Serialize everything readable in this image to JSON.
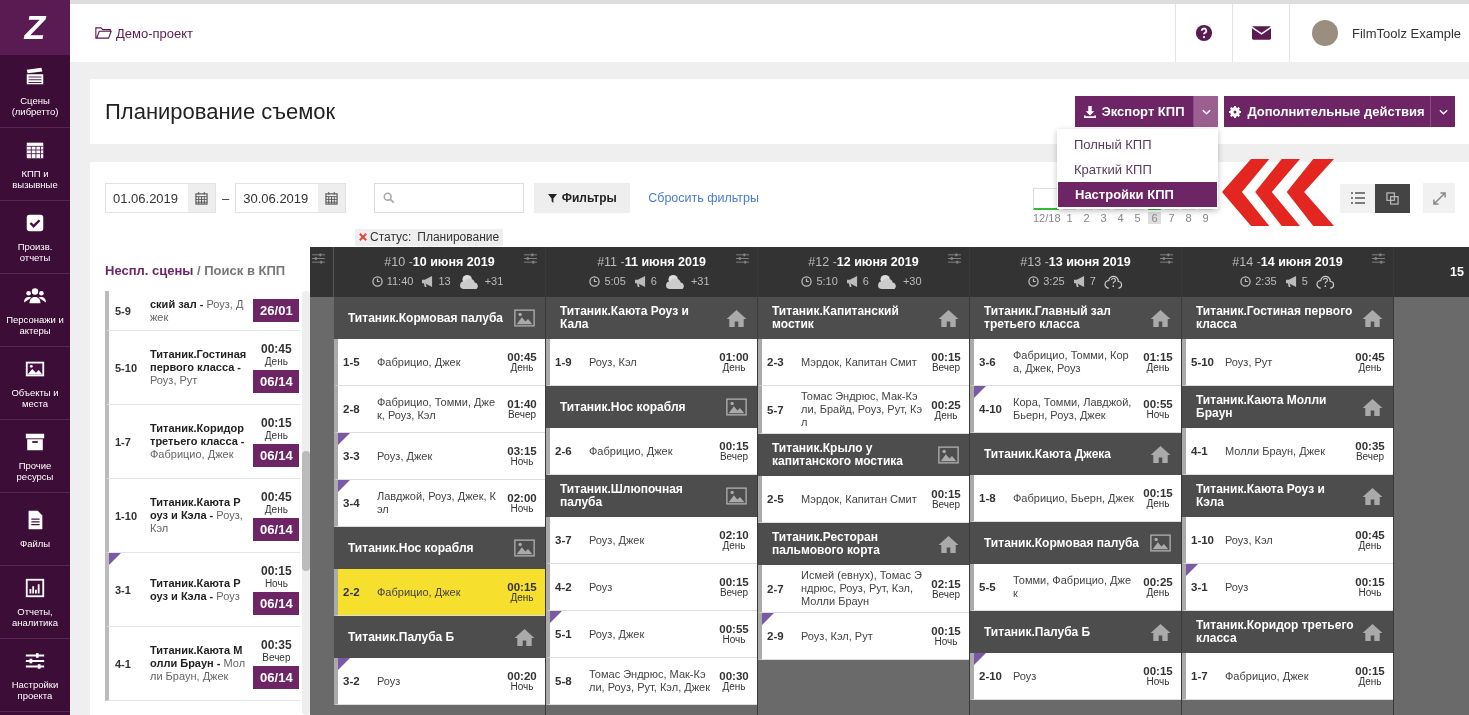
{
  "logo": "Z",
  "sidebar": {
    "items": [
      {
        "label": "Сцены (либретто)"
      },
      {
        "label": "КПП и вызывные"
      },
      {
        "label": "Произв. отчеты"
      },
      {
        "label": "Персонажи и актеры"
      },
      {
        "label": "Объекты и места"
      },
      {
        "label": "Прочие ресурсы"
      },
      {
        "label": "Файлы"
      },
      {
        "label": "Отчеты, аналитика"
      },
      {
        "label": "Настройки проекта"
      }
    ]
  },
  "topbar": {
    "breadcrumb": "Демо-проект",
    "user": "FilmToolz Example"
  },
  "page_title": "Планирование съемок",
  "export_button": {
    "label": "Экспорт КПП",
    "expanded": true
  },
  "export_menu": [
    {
      "label": "Полный КПП",
      "selected": false
    },
    {
      "label": "Краткий КПП",
      "selected": false
    },
    {
      "label": "Настройки КПП",
      "selected": true
    }
  ],
  "actions_button": {
    "label": "Дополнительные действия"
  },
  "filters": {
    "date_from": "01.06.2019",
    "date_to": "30.06.2019",
    "dash": "–",
    "filter_button": "Фильтры",
    "reset_link": "Сбросить фильтры",
    "chip_label": "Статус:",
    "chip_value": "Планирование"
  },
  "day_strip": {
    "total": "12/18",
    "days": [
      {
        "label": "1",
        "selected": false
      },
      {
        "label": "2",
        "selected": false
      },
      {
        "label": "3",
        "selected": false
      },
      {
        "label": "4",
        "selected": false
      },
      {
        "label": "5",
        "selected": false
      },
      {
        "label": "6",
        "selected": true
      },
      {
        "label": "7",
        "selected": false
      },
      {
        "label": "8",
        "selected": false
      },
      {
        "label": "9",
        "selected": false
      }
    ]
  },
  "view_buttons": [
    {
      "kind": "list",
      "selected": false
    },
    {
      "kind": "board",
      "selected": true
    }
  ],
  "unscheduled": {
    "title": "Неспл. сцены",
    "search_tab": "/ Поиск в КПП",
    "items": [
      {
        "scene": "5-9",
        "text": "**ский зал -** Роуз, Джек",
        "badge": "26/01",
        "flagged": false
      },
      {
        "scene": "5-10",
        "text": "**Титаник.Гостиная первого класса -** Роуз, Рут",
        "time": "00:45",
        "daypart": "День",
        "badge": "06/14",
        "flagged": false
      },
      {
        "scene": "1-7",
        "text": "**Титаник.Коридор третьего класса -** Фабрицио, Джек",
        "time": "00:15",
        "daypart": "День",
        "badge": "06/14",
        "flagged": false
      },
      {
        "scene": "1-10",
        "text": "**Титаник.Каюта Роуз и Кэла -** Роуз, Кэл",
        "time": "00:45",
        "daypart": "День",
        "badge": "06/14",
        "flagged": false
      },
      {
        "scene": "3-1",
        "text": "**Титаник.Каюта Роуз и Кэла -** Роуз",
        "time": "00:15",
        "daypart": "Ночь",
        "badge": "06/14",
        "flagged": true
      },
      {
        "scene": "4-1",
        "text": "**Титаник.Каюта Молли Браун -** Молли Браун, Джек",
        "time": "00:35",
        "daypart": "Вечер",
        "badge": "06/14",
        "flagged": false
      }
    ]
  },
  "board": {
    "columns": [
      {
        "number": "#10 -",
        "date": "10 июня 2019",
        "duration": "11:40",
        "scene_count": "13",
        "weather": {
          "kind": "cloudy",
          "temperature": "+31"
        },
        "groups": [
          {
            "place": "Титаник.Кормовая палуба",
            "kind": "exterior",
            "scenes": [
              {
                "scene": "1-5",
                "cast": "Фабрицио, Джек",
                "time": "00:45",
                "daypart": "День",
                "flagged": false,
                "highlighted": false
              },
              {
                "scene": "2-8",
                "cast": "Фабрицио, Томми, Джек, Роуз, Кэл",
                "time": "01:40",
                "daypart": "Вечер",
                "flagged": false,
                "highlighted": false
              },
              {
                "scene": "3-3",
                "cast": "Роуз, Джек",
                "time": "03:15",
                "daypart": "Ночь",
                "flagged": true,
                "highlighted": false
              },
              {
                "scene": "3-4",
                "cast": "Лавджой, Роуз, Джек, Кэл",
                "time": "02:00",
                "daypart": "Ночь",
                "flagged": true,
                "highlighted": false
              }
            ]
          },
          {
            "place": "Титаник.Нос корабля",
            "kind": "exterior",
            "scenes": [
              {
                "scene": "2-2",
                "cast": "Фабрицио, Джек",
                "time": "00:15",
                "daypart": "День",
                "flagged": false,
                "highlighted": true
              }
            ]
          },
          {
            "place": "Титаник.Палуба Б",
            "kind": "interior",
            "scenes": [
              {
                "scene": "3-2",
                "cast": "Роуз",
                "time": "00:20",
                "daypart": "Ночь",
                "flagged": true,
                "highlighted": false
              }
            ]
          }
        ]
      },
      {
        "number": "#11 -",
        "date": "11 июня 2019",
        "duration": "5:05",
        "scene_count": "6",
        "weather": {
          "kind": "cloudy",
          "temperature": "+31"
        },
        "groups": [
          {
            "place": "Титаник.Каюта Роуз и Кала",
            "kind": "interior",
            "scenes": [
              {
                "scene": "1-9",
                "cast": "Роуз, Кэл",
                "time": "01:00",
                "daypart": "День",
                "flagged": false,
                "highlighted": false
              }
            ]
          },
          {
            "place": "Титаник.Нос корабля",
            "kind": "exterior",
            "scenes": [
              {
                "scene": "2-6",
                "cast": "Фабрицио, Джек",
                "time": "00:15",
                "daypart": "Вечер",
                "flagged": false,
                "highlighted": false
              }
            ]
          },
          {
            "place": "Титаник.Шлюпочная палуба",
            "kind": "exterior",
            "scenes": [
              {
                "scene": "3-7",
                "cast": "Роуз, Джек",
                "time": "02:10",
                "daypart": "День",
                "flagged": false,
                "highlighted": false
              },
              {
                "scene": "4-2",
                "cast": "Роуз",
                "time": "00:15",
                "daypart": "Вечер",
                "flagged": false,
                "highlighted": false
              },
              {
                "scene": "5-1",
                "cast": "Роуз, Джек",
                "time": "00:55",
                "daypart": "Ночь",
                "flagged": true,
                "highlighted": false
              },
              {
                "scene": "5-8",
                "cast": "Томас Эндрюс, Мак-Кэли, Роуз, Рут, Кэл, Джек",
                "time": "00:30",
                "daypart": "День",
                "flagged": false,
                "highlighted": false
              }
            ]
          }
        ]
      },
      {
        "number": "#12 -",
        "date": "12 июня 2019",
        "duration": "5:10",
        "scene_count": "6",
        "weather": {
          "kind": "cloudy",
          "temperature": "+30"
        },
        "groups": [
          {
            "place": "Титаник.Капитанский мостик",
            "kind": "interior",
            "scenes": [
              {
                "scene": "2-3",
                "cast": "Мэрдок, Капитан Смит",
                "time": "00:15",
                "daypart": "Вечер",
                "flagged": false,
                "highlighted": false
              },
              {
                "scene": "5-7",
                "cast": "Томас Эндрюс, Мак-Кэли, Брайд, Роуз, Рут, Кэл",
                "time": "00:25",
                "daypart": "День",
                "flagged": false,
                "highlighted": false
              }
            ]
          },
          {
            "place": "Титаник.Крыло у капитанского мостика",
            "kind": "exterior",
            "scenes": [
              {
                "scene": "2-5",
                "cast": "Мэрдок, Капитан Смит",
                "time": "00:15",
                "daypart": "Вечер",
                "flagged": false,
                "highlighted": false
              }
            ]
          },
          {
            "place": "Титаник.Ресторан пальмового корта",
            "kind": "interior",
            "scenes": [
              {
                "scene": "2-7",
                "cast": "Исмей (евнух), Томас Эндрюс, Роуз, Рут, Кэл, Молли Браун",
                "time": "02:15",
                "daypart": "Вечер",
                "flagged": false,
                "highlighted": false
              },
              {
                "scene": "2-9",
                "cast": "Роуз, Кэл, Рут",
                "time": "00:15",
                "daypart": "Ночь",
                "flagged": true,
                "highlighted": false
              }
            ]
          }
        ]
      },
      {
        "number": "#13 -",
        "date": "13 июня 2019",
        "duration": "3:25",
        "scene_count": "7",
        "weather": {
          "kind": "unknown"
        },
        "groups": [
          {
            "place": "Титаник.Главный зал третьего класса",
            "kind": "interior",
            "scenes": [
              {
                "scene": "3-6",
                "cast": "Фабрицио, Томми, Кора, Джек, Роуз",
                "time": "01:15",
                "daypart": "День",
                "flagged": false,
                "highlighted": false
              },
              {
                "scene": "4-10",
                "cast": "Кора, Томми, Лавджой, Бьерн, Роуз, Джек",
                "time": "00:55",
                "daypart": "Ночь",
                "flagged": true,
                "highlighted": false
              }
            ]
          },
          {
            "place": "Титаник.Каюта Джека",
            "kind": "interior",
            "scenes": [
              {
                "scene": "1-8",
                "cast": "Фабрицио, Бьерн, Джек",
                "time": "00:15",
                "daypart": "День",
                "flagged": false,
                "highlighted": false
              }
            ]
          },
          {
            "place": "Титаник.Кормовая палуба",
            "kind": "exterior",
            "scenes": [
              {
                "scene": "5-5",
                "cast": "Томми, Фабрицио, Джек",
                "time": "00:25",
                "daypart": "День",
                "flagged": false,
                "highlighted": false
              }
            ]
          },
          {
            "place": "Титаник.Палуба Б",
            "kind": "interior",
            "scenes": [
              {
                "scene": "2-10",
                "cast": "Роуз",
                "time": "00:15",
                "daypart": "Ночь",
                "flagged": true,
                "highlighted": false
              }
            ]
          }
        ]
      },
      {
        "number": "#14 -",
        "date": "14 июня 2019",
        "duration": "2:35",
        "scene_count": "5",
        "weather": {
          "kind": "unknown"
        },
        "groups": [
          {
            "place": "Титаник.Гостиная первого класса",
            "kind": "interior",
            "scenes": [
              {
                "scene": "5-10",
                "cast": "Роуз, Рут",
                "time": "00:45",
                "daypart": "День",
                "flagged": false,
                "highlighted": false
              }
            ]
          },
          {
            "place": "Титаник.Каюта Молли Браун",
            "kind": "interior",
            "scenes": [
              {
                "scene": "4-1",
                "cast": "Молли Браун, Джек",
                "time": "00:35",
                "daypart": "Вечер",
                "flagged": false,
                "highlighted": false
              }
            ]
          },
          {
            "place": "Титаник.Каюта Роуз и Кэла",
            "kind": "interior",
            "scenes": [
              {
                "scene": "1-10",
                "cast": "Роуз, Кэл",
                "time": "00:45",
                "daypart": "День",
                "flagged": false,
                "highlighted": false
              },
              {
                "scene": "3-1",
                "cast": "Роуз",
                "time": "00:15",
                "daypart": "Ночь",
                "flagged": true,
                "highlighted": false
              }
            ]
          },
          {
            "place": "Титаник.Коридор третьего класса",
            "kind": "interior",
            "scenes": [
              {
                "scene": "1-7",
                "cast": "Фабрицио, Джек",
                "time": "00:15",
                "daypart": "День",
                "flagged": false,
                "highlighted": false
              }
            ]
          }
        ]
      },
      {
        "date": "15"
      }
    ]
  }
}
